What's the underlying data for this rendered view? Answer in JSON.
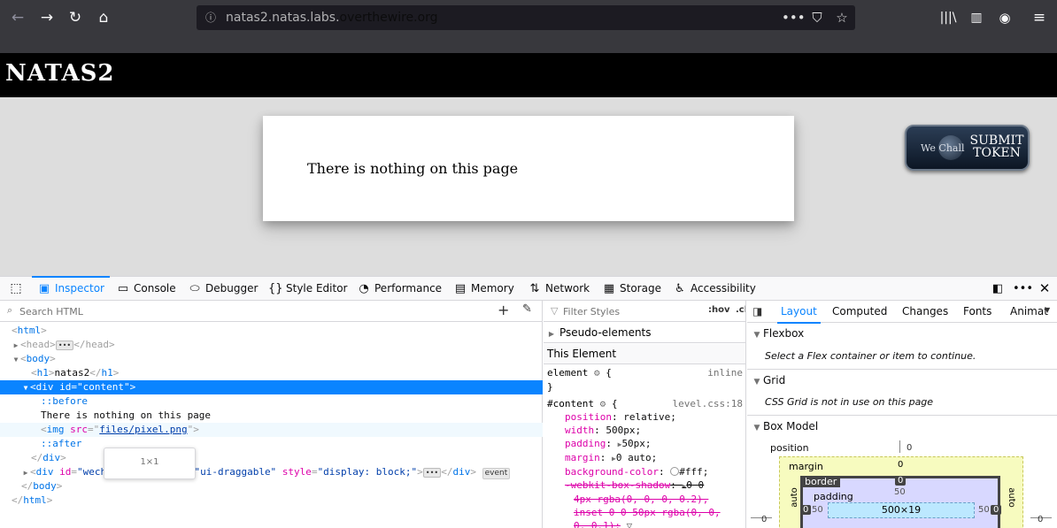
{
  "browser": {
    "url_prefix": "natas2.natas.labs.",
    "url_domain": "overthewire.org",
    "page_actions_icon": "•••"
  },
  "page": {
    "title": "NATAS2",
    "content_text": "There is nothing on this page",
    "submit_we": "We Chall",
    "submit_label_1": "SUBMIT",
    "submit_label_2": "TOKEN"
  },
  "devtools": {
    "tabs": [
      {
        "label": "Inspector",
        "icon": "inspector-icon"
      },
      {
        "label": "Console",
        "icon": "console-icon"
      },
      {
        "label": "Debugger",
        "icon": "debugger-icon"
      },
      {
        "label": "Style Editor",
        "icon": "style-editor-icon"
      },
      {
        "label": "Performance",
        "icon": "performance-icon"
      },
      {
        "label": "Memory",
        "icon": "memory-icon"
      },
      {
        "label": "Network",
        "icon": "network-icon"
      },
      {
        "label": "Storage",
        "icon": "storage-icon"
      },
      {
        "label": "Accessibility",
        "icon": "accessibility-icon"
      }
    ],
    "search_placeholder": "Search HTML",
    "tree": {
      "html": "html",
      "head": "head",
      "body": "body",
      "h1_text": "natas2",
      "h1": "h1",
      "div": "div",
      "div_id_attr": "id",
      "div_id_val": "\"content\"",
      "before": "::before",
      "content_text": "There is nothing on this page",
      "img": "img",
      "img_src_attr": "src",
      "img_src_val": "files/pixel.png",
      "after": "::after",
      "div2_id_val": "\"wechallform\"",
      "div2_class_attr": "class",
      "div2_class_val": "\"ui-draggable\"",
      "div2_style_attr": "style",
      "div2_style_val": "\"display: block;\"",
      "event_badge": "event",
      "tooltip": "1×1"
    },
    "rules": {
      "filter_placeholder": "Filter Styles",
      "hov": ":hov",
      "cls": ".cl",
      "pseudo": "Pseudo-elements",
      "this_element": "This Element",
      "element_sel": "element",
      "inline": "inline",
      "content_sel": "#content",
      "source": "level.css:18",
      "props": [
        {
          "name": "position",
          "value": "relative;"
        },
        {
          "name": "width",
          "value": "500px;"
        },
        {
          "name": "padding",
          "value": "50px;"
        },
        {
          "name": "margin",
          "value": "0 auto;"
        },
        {
          "name": "background-color",
          "value": "#fff;"
        }
      ],
      "shadow_name": "-webkit-box-shadow",
      "shadow_val_1": "0 0",
      "shadow_val_2": "4px rgba(0, 0, 0, 0.2),",
      "shadow_val_3": "inset 0 0 50px rgba(0, 0,",
      "shadow_val_4": "0, 0.1);"
    },
    "layout_tabs": [
      "Layout",
      "Computed",
      "Changes",
      "Fonts",
      "Animat"
    ],
    "flexbox_title": "Flexbox",
    "flexbox_note": "Select a Flex container or item to continue.",
    "grid_title": "Grid",
    "grid_note": "CSS Grid is not in use on this page",
    "boxmodel_title": "Box Model",
    "boxmodel": {
      "position_label": "position",
      "position_val": "0",
      "margin_label": "margin",
      "margin_top": "0",
      "border_label": "border",
      "border_top": "0",
      "padding_label": "padding",
      "padding_top": "50",
      "padding_left": "50",
      "padding_right": "50",
      "border_left": "0",
      "border_right": "0",
      "margin_left": "auto",
      "margin_right": "auto",
      "pos_left": "0",
      "pos_right": "0",
      "content_size": "500×19"
    }
  }
}
